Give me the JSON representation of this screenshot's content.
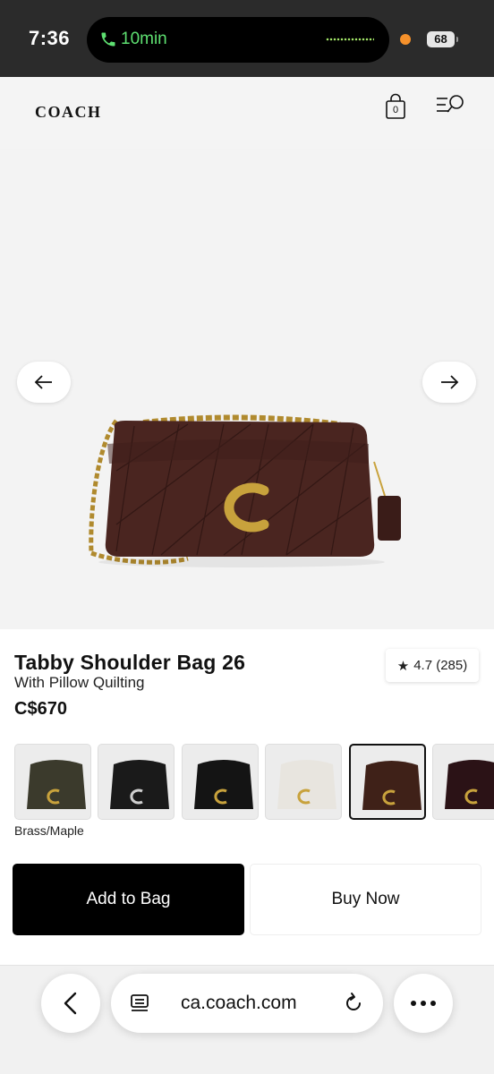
{
  "status_bar": {
    "time": "7:36",
    "call_label": "10min",
    "battery": "68"
  },
  "header": {
    "logo": "COACH",
    "bag_count": "0",
    "icons": [
      "shopping-bag-icon",
      "menu-search-icon"
    ]
  },
  "product": {
    "title": "Tabby Shoulder Bag 26",
    "subtitle": "With Pillow Quilting",
    "price": "C$670",
    "rating": "4.7 (285)",
    "selected_color": "Brass/Maple",
    "swatches": [
      {
        "color": "#3b3a2c"
      },
      {
        "color": "#1a1a1a"
      },
      {
        "color": "#141414"
      },
      {
        "color": "#e8e5df"
      },
      {
        "color": "#3f2118"
      },
      {
        "color": "#2b1216"
      }
    ]
  },
  "actions": {
    "add_to_bag": "Add to Bag",
    "buy_now": "Buy Now"
  },
  "browser": {
    "url": "ca.coach.com"
  },
  "colors": {
    "accent_black": "#000000",
    "call_green": "#5ee071",
    "bag_brown": "#4a2520",
    "hardware_gold": "#c8a23c"
  }
}
